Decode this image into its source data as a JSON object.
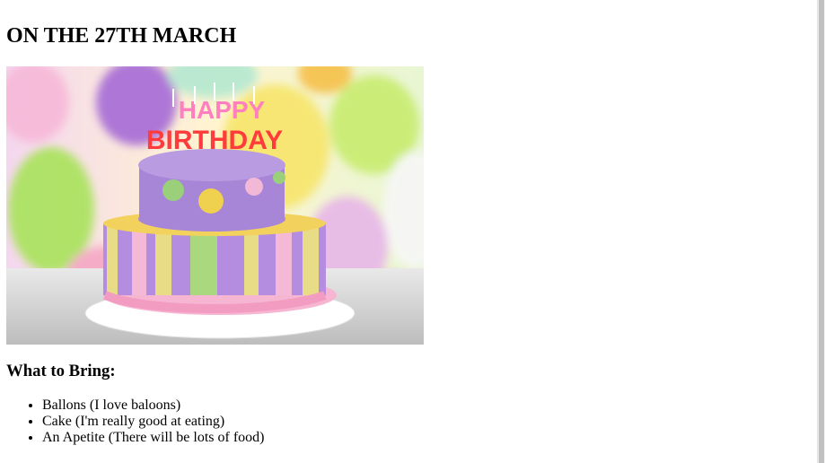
{
  "heading": "ON THE 27TH MARCH",
  "image": {
    "subject": "birthday-cake",
    "topper_text": [
      "HAPPY",
      "BIRTHDAY"
    ]
  },
  "bring_heading": "What to Bring:",
  "bring_items": [
    "Ballons (I love baloons)",
    "Cake (I'm really good at eating)",
    "An Apetite (There will be lots of food)"
  ]
}
